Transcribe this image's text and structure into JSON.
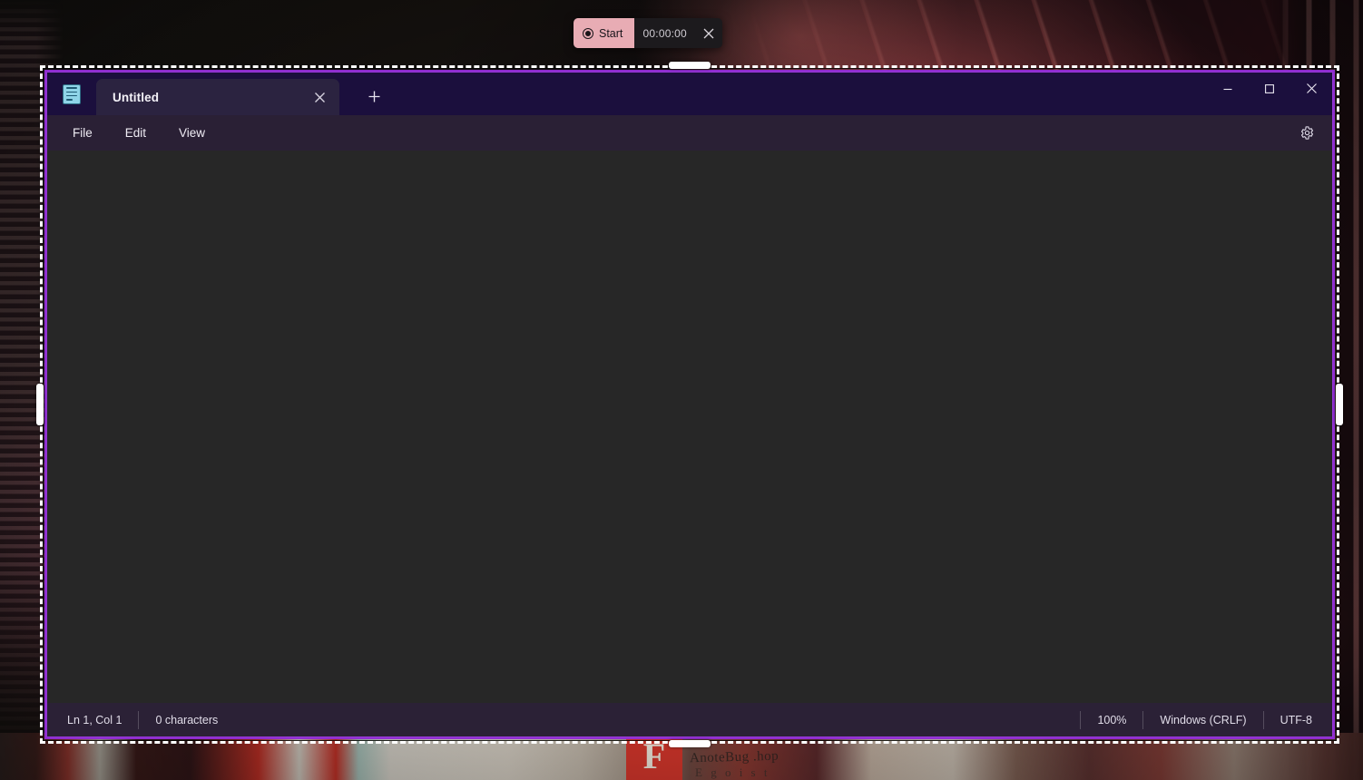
{
  "recorder": {
    "start_label": "Start",
    "record_icon": "record-circle-icon",
    "timer": "00:00:00",
    "close_icon": "close-icon"
  },
  "window": {
    "app": "Notepad",
    "app_icon": "notepad-icon",
    "tabs": [
      {
        "title": "Untitled",
        "active": true,
        "close_icon": "close-icon"
      }
    ],
    "new_tab_icon": "plus-icon",
    "controls": {
      "minimize": "minimize-icon",
      "maximize": "maximize-icon",
      "close": "close-icon"
    }
  },
  "menubar": {
    "items": [
      {
        "label": "File"
      },
      {
        "label": "Edit"
      },
      {
        "label": "View"
      }
    ],
    "settings_icon": "gear-icon"
  },
  "editor": {
    "value": "",
    "placeholder": ""
  },
  "statusbar": {
    "cursor": "Ln 1, Col 1",
    "characters": "0 characters",
    "zoom": "100%",
    "line_endings": "Windows (CRLF)",
    "encoding": "UTF-8"
  },
  "wallpaper": {
    "sign_text": "AnoteBug .hop",
    "sign_subtext": "E g o i s t",
    "sign_letter": "F"
  },
  "colors": {
    "selection_border": "#ffffff",
    "selection_glow": "#922dd6",
    "titlebar": "#1b0f3d",
    "tab_active": "#2b2340",
    "menubar": "#2a2035",
    "editor_bg": "#272727",
    "statusbar": "#2b2136",
    "recorder_bg": "#1c1a1d",
    "recorder_start": "#e8acb4"
  }
}
